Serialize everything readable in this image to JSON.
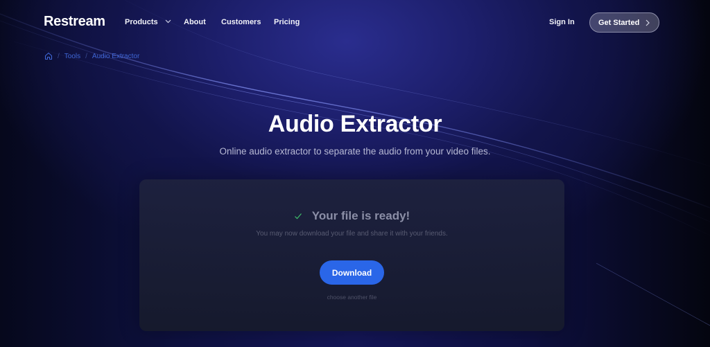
{
  "nav": {
    "logo": "Restream",
    "items": [
      {
        "label": "Products",
        "has_dropdown": true
      },
      {
        "label": "About"
      },
      {
        "label": "Customers"
      },
      {
        "label": "Pricing"
      }
    ],
    "sign_in": "Sign In",
    "get_started": "Get Started"
  },
  "breadcrumb": {
    "home_icon": "home-icon",
    "items": [
      "Tools",
      "Audio Extractor"
    ],
    "separator": "/"
  },
  "hero": {
    "title": "Audio Extractor",
    "subtitle": "Online audio extractor to separate the audio from your video files."
  },
  "card": {
    "status_icon": "check-icon",
    "title": "Your file is ready!",
    "subtitle": "You may now download your file and share it with your friends.",
    "download_label": "Download",
    "choose_another": "choose another file"
  },
  "colors": {
    "accent": "#2a66e8",
    "check": "#3fbf6a",
    "breadcrumb_link": "#3f66d6",
    "background": "#070922"
  }
}
